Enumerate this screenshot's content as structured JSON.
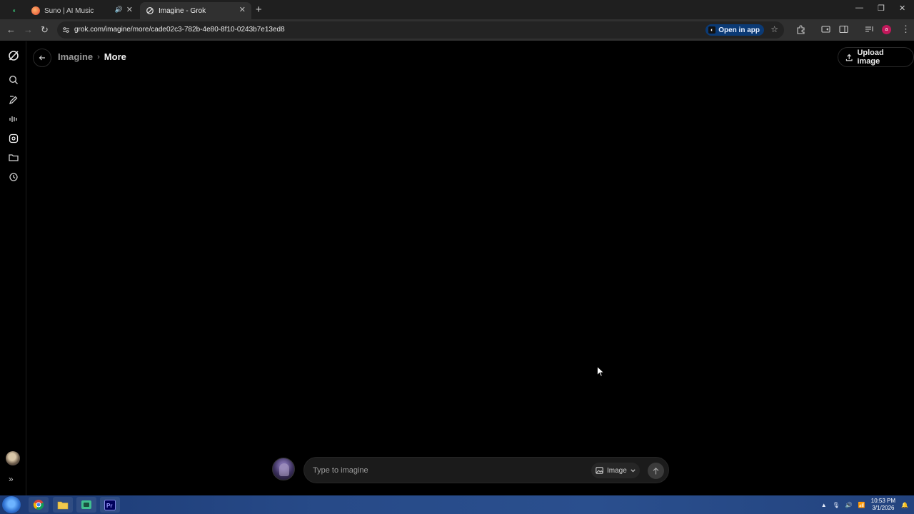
{
  "browser": {
    "tabs": [
      {
        "title": ""
      },
      {
        "title": "Suno | AI Music"
      },
      {
        "title": "Imagine - Grok"
      }
    ],
    "url": "grok.com/imagine/more/cade02c3-782b-4e80-8f10-0243b7e13ed8",
    "open_in_app": "Open in app",
    "profile_initial": "a"
  },
  "header": {
    "breadcrumb_imagine": "Imagine",
    "breadcrumb_sep": "›",
    "breadcrumb_current": "More",
    "upload_label": "Upload image"
  },
  "composer": {
    "placeholder": "Type to imagine",
    "mode": "Image"
  },
  "taskbar": {
    "time": "10:53 PM",
    "date": "3/1/2026"
  },
  "colors": {
    "background": "#000000",
    "open_app_bg": "#0b3a75",
    "profile_bg": "#c2185b"
  }
}
